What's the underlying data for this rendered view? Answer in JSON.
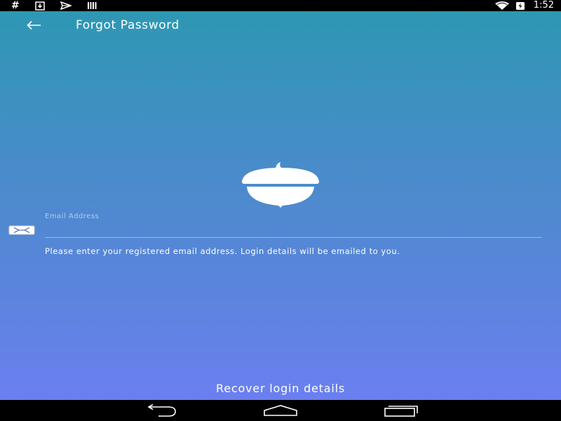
{
  "status_bar": {
    "left_icons": [
      "hash-icon",
      "download-icon",
      "send-icon",
      "bars-icon"
    ],
    "hash_glyph": "#",
    "right_icons": [
      "wifi-icon",
      "battery-charging-icon"
    ],
    "time": "1:52"
  },
  "toolbar": {
    "back_icon": "arrow-left-icon",
    "title": "Forgot Password"
  },
  "logo": {
    "icon": "acorn-icon"
  },
  "form": {
    "email_label": "Email Address",
    "email_value": "",
    "email_icon": "envelope-icon",
    "helper_text": "Please enter your registered email address. Login details will be emailed to you."
  },
  "actions": {
    "recover_label": "Recover login details"
  },
  "nav_bar": {
    "items": [
      "back-nav-icon",
      "home-nav-icon",
      "recents-nav-icon"
    ]
  },
  "colors": {
    "gradient_top": "#2e97b4",
    "gradient_mid": "#4f89cf",
    "gradient_bottom": "#6b7ff0",
    "input_underline": "#7fd29a",
    "text": "#ffffff"
  }
}
